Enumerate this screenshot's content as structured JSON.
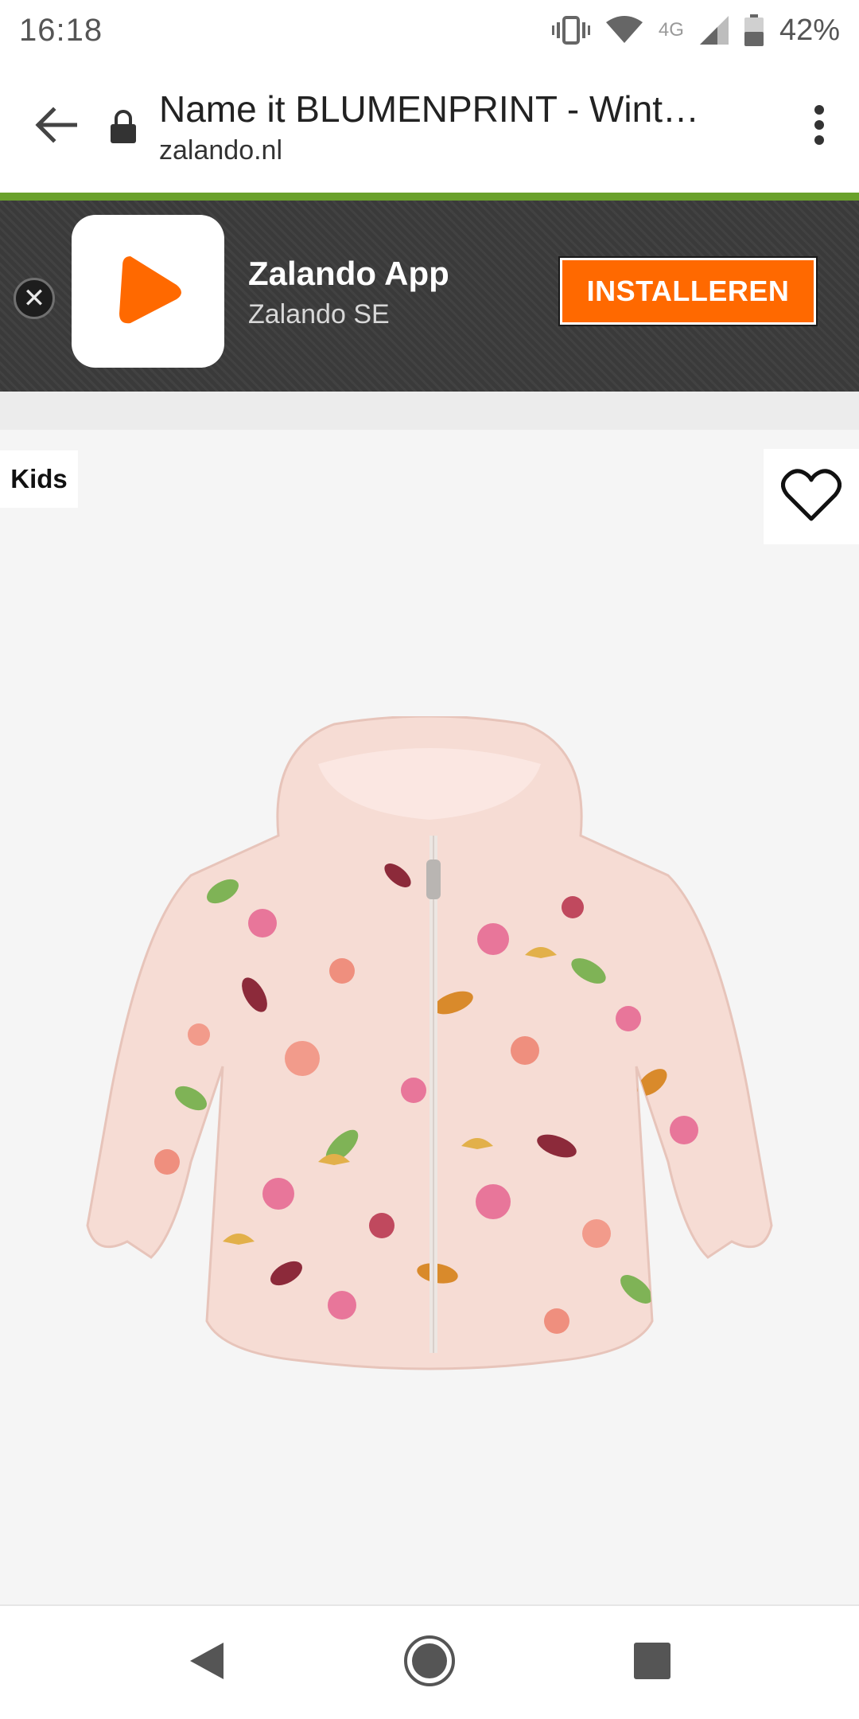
{
  "status_bar": {
    "time": "16:18",
    "network": "4G",
    "battery": "42%",
    "icons": [
      "vibrate-icon",
      "wifi-icon",
      "signal-icon",
      "battery-icon"
    ]
  },
  "browser": {
    "page_title": "Name it BLUMENPRINT - Winte…",
    "domain": "zalando.nl",
    "icons": [
      "back-arrow-icon",
      "lock-icon",
      "overflow-menu-icon"
    ]
  },
  "app_banner": {
    "app_name": "Zalando App",
    "publisher": "Zalando SE",
    "install_label": "INSTALLEREN",
    "icons": [
      "close-icon",
      "zalando-logo-icon"
    ]
  },
  "product": {
    "badge": "Kids",
    "icons": [
      "heart-icon"
    ],
    "image": "floral-hooded-winter-jacket"
  },
  "nav_bar": {
    "icons": [
      "nav-back-icon",
      "nav-home-icon",
      "nav-recents-icon"
    ]
  },
  "colors": {
    "accent_green": "#6aa12c",
    "brand_orange": "#ff6900",
    "banner_bg": "#3a3a3a",
    "product_bg": "#f5f5f5"
  }
}
